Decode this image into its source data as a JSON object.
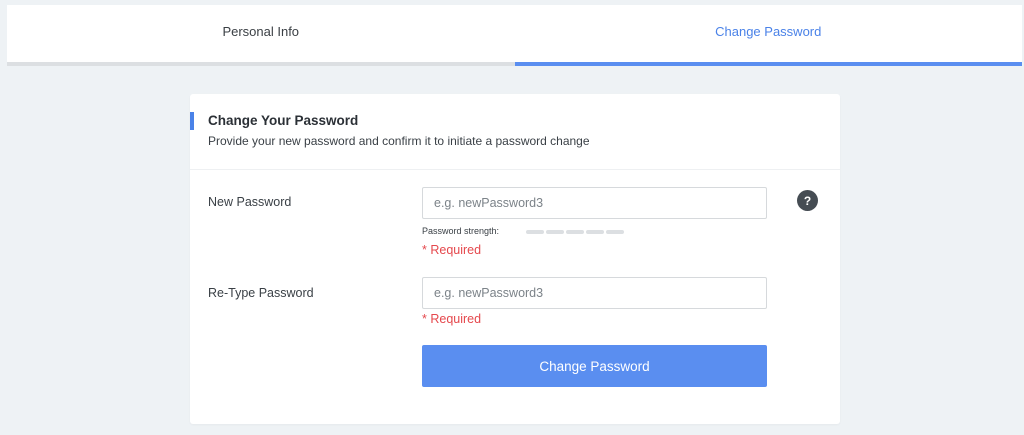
{
  "tabs": [
    {
      "label": "Personal Info",
      "active": false
    },
    {
      "label": "Change Password",
      "active": true
    }
  ],
  "card": {
    "title": "Change Your Password",
    "subtitle": "Provide your new password and confirm it to initiate a password change"
  },
  "form": {
    "new_password": {
      "label": "New Password",
      "placeholder": "e.g. newPassword3",
      "value": "",
      "required_text": "* Required",
      "help_icon": "question-mark-icon",
      "help_glyph": "?"
    },
    "strength": {
      "label": "Password strength:",
      "level": 0,
      "segments": 5
    },
    "retype_password": {
      "label": "Re-Type Password",
      "placeholder": "e.g. newPassword3",
      "value": "",
      "required_text": "* Required"
    },
    "submit_label": "Change Password"
  },
  "colors": {
    "accent": "#5a8ef0",
    "error": "#e5484d",
    "background": "#eef2f5"
  }
}
